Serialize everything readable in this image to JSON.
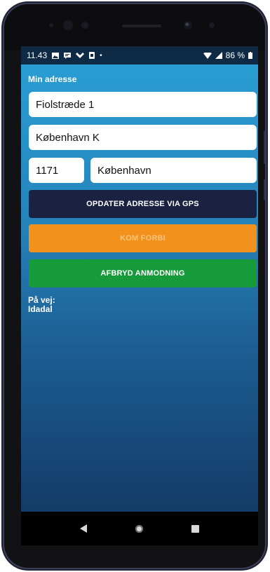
{
  "status_bar": {
    "time": "11.43",
    "battery": "86 %",
    "icons": [
      "image-icon",
      "message-icon",
      "assistant-icon",
      "sim-icon",
      "dot-icon",
      "wifi-icon",
      "signal-icon",
      "battery-icon"
    ]
  },
  "address": {
    "section_label": "Min adresse",
    "street": "Fiolstræde 1",
    "city_area": "København K",
    "postal_code": "1171",
    "city": "København"
  },
  "buttons": {
    "gps_label": "OPDATER ADRESSE VIA GPS",
    "come_by_label": "KOM FORBI",
    "cancel_label": "AFBRYD ANMODNING"
  },
  "colors": {
    "gps_button": "#1b2140",
    "come_by_button": "#f2921d",
    "come_by_text": "#f8c27a",
    "cancel_button": "#179a3a"
  },
  "en_route": {
    "label": "På vej:",
    "name": "Idadal"
  },
  "navigation": [
    "back-icon",
    "home-icon",
    "recent-apps-icon"
  ]
}
